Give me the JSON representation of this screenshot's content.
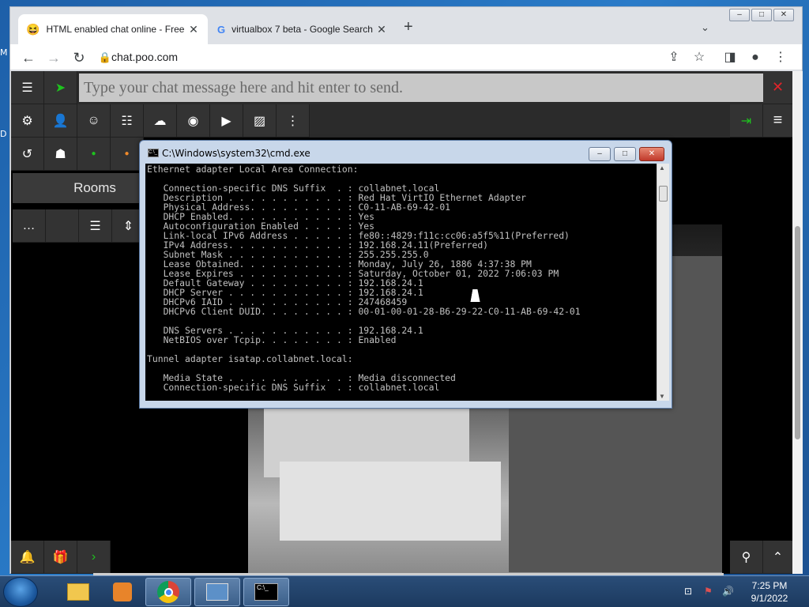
{
  "desktop": {
    "labels": [
      "M",
      "D"
    ]
  },
  "browser": {
    "tabs": [
      {
        "title": "HTML enabled chat online - Free",
        "active": true
      },
      {
        "title": "virtualbox 7 beta - Google Search",
        "active": false
      }
    ],
    "new_tab": "+",
    "url": "chat.poo.com",
    "window_controls": [
      "–",
      "□",
      "✕"
    ]
  },
  "chat": {
    "input_placeholder": "Type your chat message here and hit enter to send.",
    "rooms_label": "Rooms"
  },
  "cmd": {
    "title": "C:\\Windows\\system32\\cmd.exe",
    "icon_text": "C:\\_",
    "lines": [
      "Ethernet adapter Local Area Connection:",
      "",
      "   Connection-specific DNS Suffix  . : collabnet.local",
      "   Description . . . . . . . . . . . : Red Hat VirtIO Ethernet Adapter",
      "   Physical Address. . . . . . . . . : C0-11-AB-69-42-01",
      "   DHCP Enabled. . . . . . . . . . . : Yes",
      "   Autoconfiguration Enabled . . . . : Yes",
      "   Link-local IPv6 Address . . . . . : fe80::4829:f11c:cc06:a5f5%11(Preferred)",
      "   IPv4 Address. . . . . . . . . . . : 192.168.24.11(Preferred)",
      "   Subnet Mask . . . . . . . . . . . : 255.255.255.0",
      "   Lease Obtained. . . . . . . . . . : Monday, July 26, 1886 4:37:38 PM",
      "   Lease Expires . . . . . . . . . . : Saturday, October 01, 2022 7:06:03 PM",
      "   Default Gateway . . . . . . . . . : 192.168.24.1",
      "   DHCP Server . . . . . . . . . . . : 192.168.24.1",
      "   DHCPv6 IAID . . . . . . . . . . . : 247468459",
      "   DHCPv6 Client DUID. . . . . . . . : 00-01-00-01-28-B6-29-22-C0-11-AB-69-42-01",
      "",
      "   DNS Servers . . . . . . . . . . . : 192.168.24.1",
      "   NetBIOS over Tcpip. . . . . . . . : Enabled",
      "",
      "Tunnel adapter isatap.collabnet.local:",
      "",
      "   Media State . . . . . . . . . . . : Media disconnected",
      "   Connection-specific DNS Suffix  . : collabnet.local"
    ]
  },
  "taskbar": {
    "clock_time": "7:25 PM",
    "clock_date": "9/1/2022"
  },
  "colors": {
    "accent_green": "#1ec31e",
    "close_red": "#e0242a",
    "chat_bg": "#2b2b2b",
    "status_orange": "#f08a2a"
  }
}
